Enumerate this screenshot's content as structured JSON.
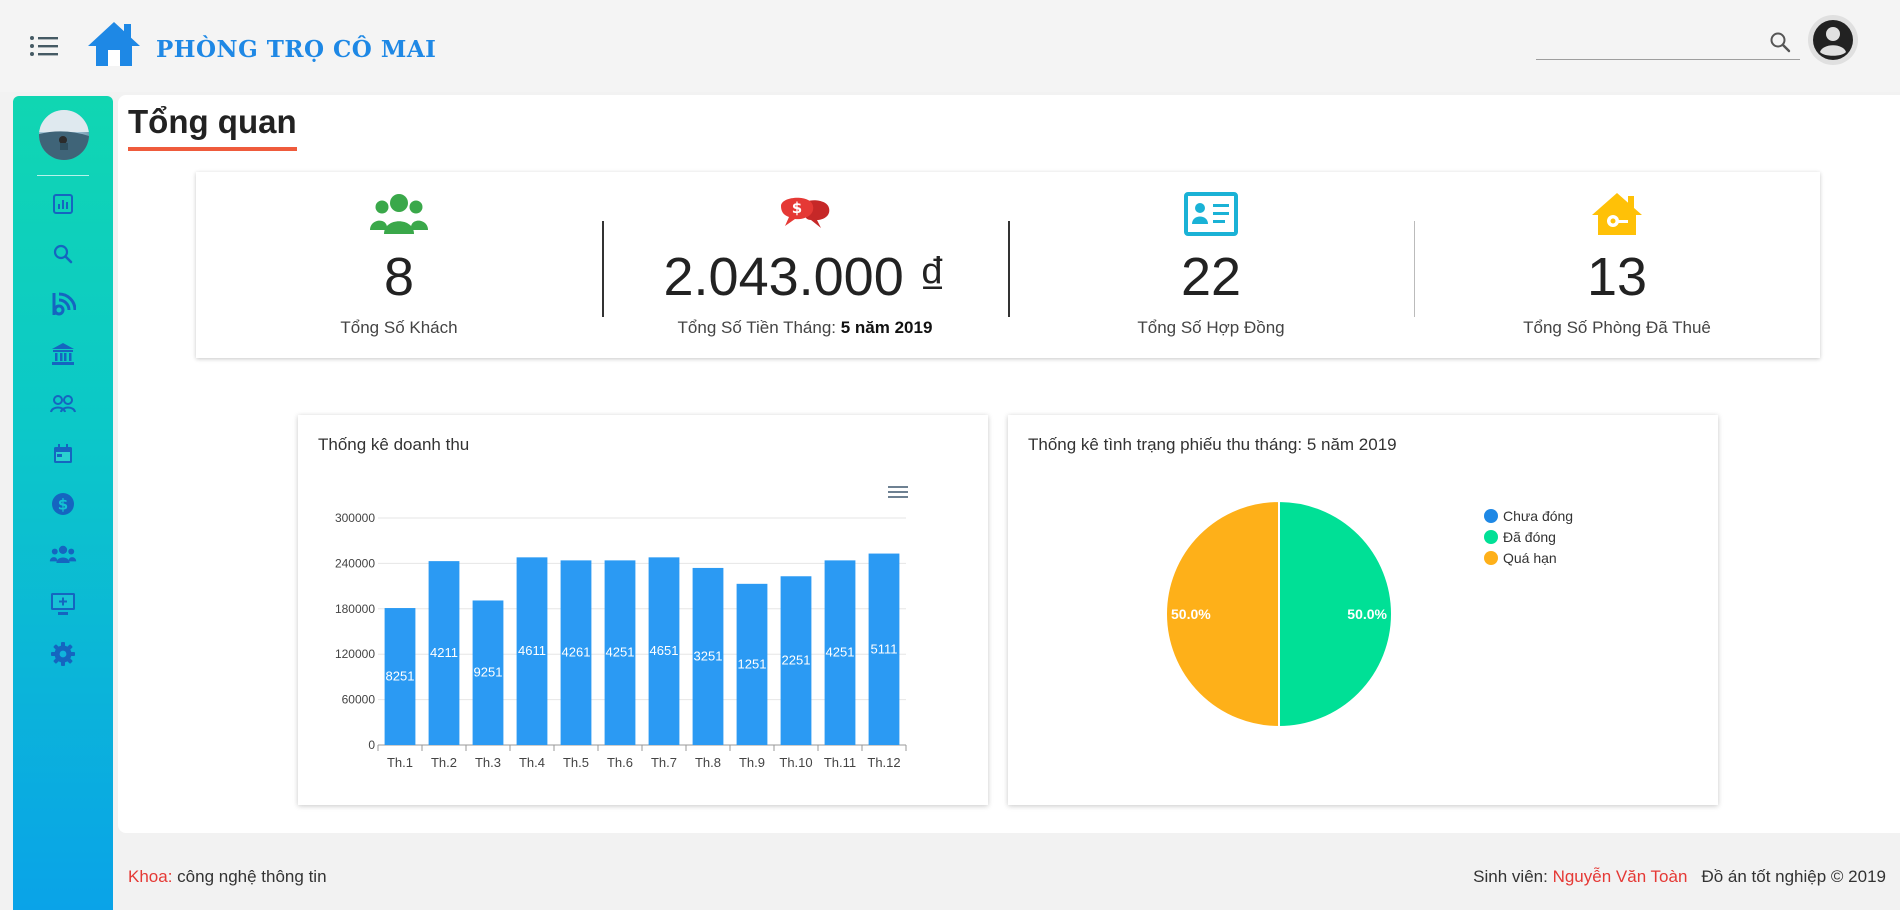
{
  "header": {
    "brand": "PHÒNG TRỌ CÔ MAI",
    "search_value": "",
    "icons": [
      "menu-icon",
      "house-logo-icon",
      "search-icon",
      "account-circle-icon"
    ]
  },
  "sidebar": {
    "items": [
      {
        "icon": "chart-icon"
      },
      {
        "icon": "search-icon"
      },
      {
        "icon": "rss-feed-icon"
      },
      {
        "icon": "bank-icon"
      },
      {
        "icon": "users-outline-icon"
      },
      {
        "icon": "calendar-icon"
      },
      {
        "icon": "dollar-circle-icon"
      },
      {
        "icon": "users-group-icon"
      },
      {
        "icon": "monitor-add-icon"
      },
      {
        "icon": "gear-icon"
      }
    ]
  },
  "main": {
    "title": "Tổng quan",
    "stats": [
      {
        "value": "8",
        "label": "Tổng Số Khách",
        "icon": "users-icon",
        "color": "#3aa84a"
      },
      {
        "value": "2.043.000 ₫",
        "label": "Tổng Số Tiền Tháng:",
        "label_bold": "5 năm 2019",
        "icon": "money-chat-icon",
        "color": "#e53935"
      },
      {
        "value": "22",
        "label": "Tổng Số Hợp Đồng",
        "icon": "contract-card-icon",
        "color": "#1ab2d6"
      },
      {
        "value": "13",
        "label": "Tổng Số Phòng Đã Thuê",
        "icon": "house-key-icon",
        "color": "#ffc107"
      }
    ]
  },
  "chart_data": [
    {
      "type": "bar",
      "title": "Thống kê doanh thu",
      "categories": [
        "Th.1",
        "Th.2",
        "Th.3",
        "Th.4",
        "Th.5",
        "Th.6",
        "Th.7",
        "Th.8",
        "Th.9",
        "Th.10",
        "Th.11",
        "Th.12"
      ],
      "values": [
        181000,
        243000,
        191000,
        248000,
        244000,
        244000,
        248000,
        234000,
        213000,
        223000,
        244000,
        253000
      ],
      "data_labels": [
        "8251",
        "4211",
        "9251",
        "4611",
        "4261",
        "4251",
        "4651",
        "3251",
        "1251",
        "2251",
        "4251",
        "5111"
      ],
      "yticks": [
        "0",
        "60000",
        "120000",
        "180000",
        "240000",
        "300000"
      ],
      "ylim": [
        0,
        300000
      ],
      "color": "#2b9af3",
      "grid": true
    },
    {
      "type": "pie",
      "title": "Thống kê tình trạng phiếu thu tháng: 5 năm 2019",
      "legend_position": "right",
      "slices": [
        {
          "label": "Chưa đóng",
          "value": 0,
          "color": "#1e88e5"
        },
        {
          "label": "Đã đóng",
          "value": 50.0,
          "color": "#00e096"
        },
        {
          "label": "Quá hạn",
          "value": 50.0,
          "color": "#feb019"
        }
      ],
      "slice_labels": [
        "50.0%",
        "50.0%"
      ]
    }
  ],
  "footer": {
    "dept_label": "Khoa:",
    "dept_value": "công nghệ thông tin",
    "student_label": "Sinh viên:",
    "student_name": "Nguyễn Văn Toàn",
    "copyright": "Đồ án tốt nghiệp © 2019"
  }
}
